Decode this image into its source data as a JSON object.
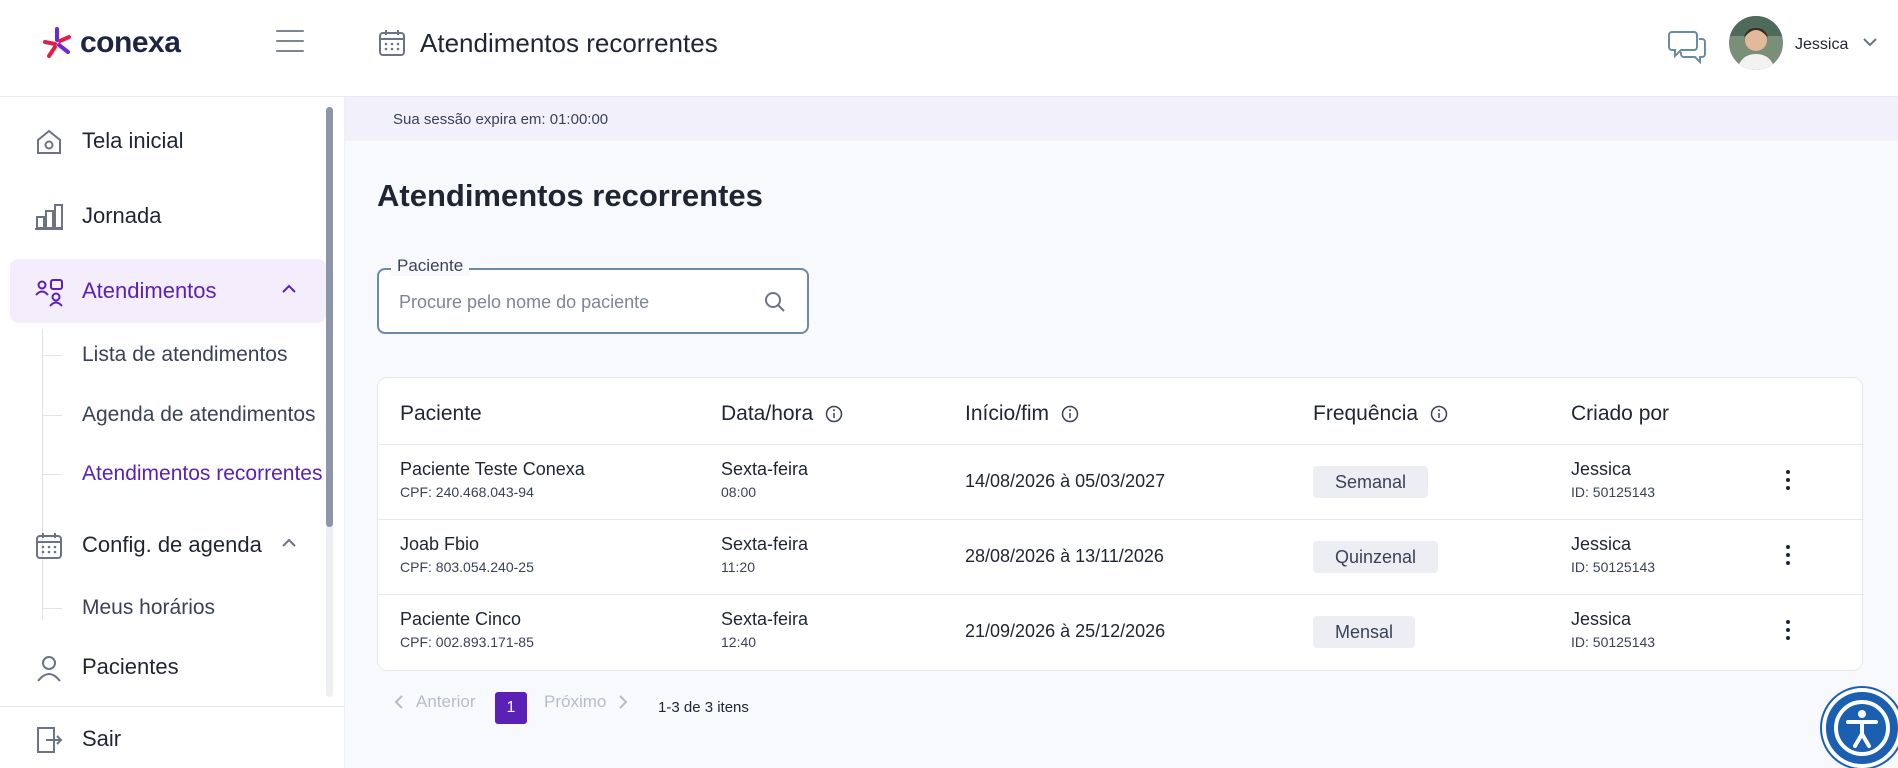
{
  "brand": {
    "name": "conexa"
  },
  "header": {
    "title": "Atendimentos recorrentes",
    "user_name": "Jessica"
  },
  "sidebar": {
    "items": [
      {
        "label": "Tela inicial"
      },
      {
        "label": "Jornada"
      },
      {
        "label": "Atendimentos"
      },
      {
        "label": "Config. de agenda"
      },
      {
        "label": "Pacientes"
      },
      {
        "label": "Sair"
      }
    ],
    "atendimentos_sub": [
      {
        "label": "Lista de atendimentos"
      },
      {
        "label": "Agenda de atendimentos"
      },
      {
        "label": "Atendimentos recorrentes"
      }
    ],
    "agenda_sub": [
      {
        "label": "Meus horários"
      }
    ]
  },
  "session": {
    "text": "Sua sessão expira em: 01:00:00"
  },
  "main": {
    "title": "Atendimentos recorrentes",
    "search": {
      "label": "Paciente",
      "placeholder": "Procure pelo nome do paciente",
      "value": ""
    }
  },
  "table": {
    "headers": [
      "Paciente",
      "Data/hora",
      "Início/fim",
      "Frequência",
      "Criado por"
    ],
    "rows": [
      {
        "name": "Paciente Teste Conexa",
        "cpf": "CPF: 240.468.043-94",
        "day": "Sexta-feira",
        "time": "08:00",
        "range": "14/08/2026 à 05/03/2027",
        "frequency": "Semanal",
        "creator": "Jessica",
        "creator_id": "ID: 50125143"
      },
      {
        "name": "Joab Fbio",
        "cpf": "CPF: 803.054.240-25",
        "day": "Sexta-feira",
        "time": "11:20",
        "range": "28/08/2026 à 13/11/2026",
        "frequency": "Quinzenal",
        "creator": "Jessica",
        "creator_id": "ID: 50125143"
      },
      {
        "name": "Paciente Cinco",
        "cpf": "CPF: 002.893.171-85",
        "day": "Sexta-feira",
        "time": "12:40",
        "range": "21/09/2026 à 25/12/2026",
        "frequency": "Mensal",
        "creator": "Jessica",
        "creator_id": "ID: 50125143"
      }
    ]
  },
  "pagination": {
    "prev": "Anterior",
    "page": "1",
    "next": "Próximo",
    "count": "1-3 de 3 itens"
  },
  "colors": {
    "accent": "#5b21b6",
    "active_bg": "#f4eefc",
    "session_bg": "#f2f0fa"
  }
}
